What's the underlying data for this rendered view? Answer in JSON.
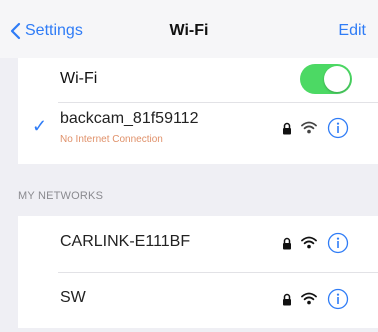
{
  "navbar": {
    "back_label": "Settings",
    "title": "Wi-Fi",
    "edit_label": "Edit"
  },
  "wifi_toggle": {
    "label": "Wi-Fi",
    "state": "on"
  },
  "connected_network": {
    "name": "backcam_81f59112",
    "status": "No Internet Connection",
    "secured": true
  },
  "sections": {
    "my_networks": "MY NETWORKS"
  },
  "my_networks": [
    {
      "name": "CARLINK-E111BF",
      "secured": true
    },
    {
      "name": "SW",
      "secured": true
    }
  ],
  "colors": {
    "accent": "#2f7cf6",
    "toggle_on": "#4cd964",
    "warning": "#e0916a",
    "background": "#efeff4"
  }
}
